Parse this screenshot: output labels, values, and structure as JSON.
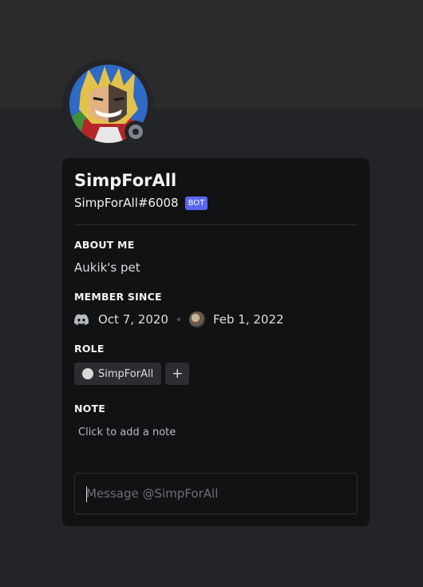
{
  "profile": {
    "display_name": "SimpForAll",
    "tag": "SimpForAll#6008",
    "badge": "BOT",
    "status": "offline"
  },
  "about": {
    "title": "ABOUT ME",
    "text": "Aukik's pet"
  },
  "member_since": {
    "title": "MEMBER SINCE",
    "discord_date": "Oct 7, 2020",
    "server_date": "Feb 1, 2022"
  },
  "role": {
    "title": "ROLE",
    "items": [
      {
        "name": "SimpForAll",
        "color": "#d9d9d9"
      }
    ],
    "add_label": "+"
  },
  "note": {
    "title": "NOTE",
    "placeholder": "Click to add a note"
  },
  "message": {
    "placeholder": "Message @SimpForAll"
  },
  "colors": {
    "background": "#232428",
    "banner": "#2b2b2b",
    "card": "#111214",
    "badge": "#5865f2",
    "status_offline": "#80848e"
  }
}
